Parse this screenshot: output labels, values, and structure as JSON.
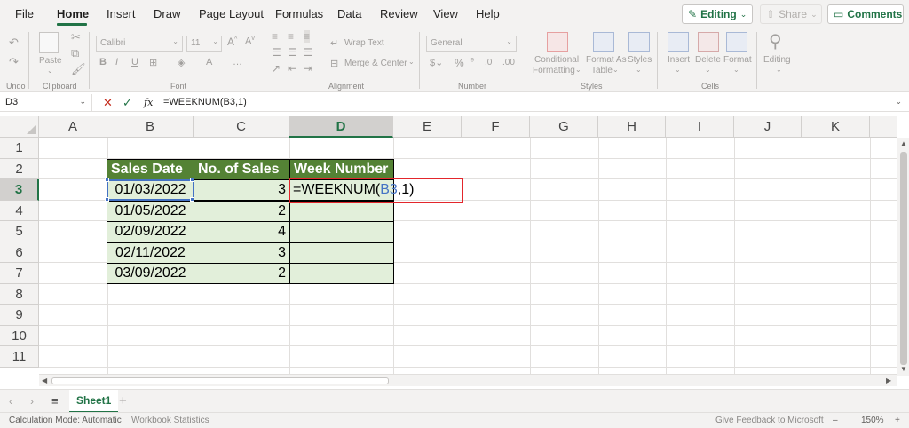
{
  "menu": {
    "tabs": [
      "File",
      "Home",
      "Insert",
      "Draw",
      "Page Layout",
      "Formulas",
      "Data",
      "Review",
      "View",
      "Help"
    ],
    "active": "Home",
    "editing_label": "Editing",
    "share_label": "Share",
    "comments_label": "Comments"
  },
  "ribbon": {
    "undo_group": "Undo",
    "clipboard_group": "Clipboard",
    "paste_label": "Paste",
    "font_name": "Calibri",
    "font_size": "11",
    "font_group": "Font",
    "wrap_text": "Wrap Text",
    "merge_center": "Merge & Center",
    "alignment_group": "Alignment",
    "number_format": "General",
    "number_group": "Number",
    "conditional_formatting_1": "Conditional",
    "conditional_formatting_2": "Formatting",
    "format_as_table_1": "Format As",
    "format_as_table_2": "Table",
    "styles_label": "Styles",
    "styles_group": "Styles",
    "insert_label": "Insert",
    "delete_label": "Delete",
    "format_label": "Format",
    "cells_group": "Cells",
    "editing_label": "Editing"
  },
  "formula_bar": {
    "name_box": "D3",
    "formula": "=WEEKNUM(B3,1)"
  },
  "grid": {
    "columns": [
      "A",
      "B",
      "C",
      "D",
      "E",
      "F",
      "G",
      "H",
      "I",
      "J",
      "K"
    ],
    "rows": [
      "1",
      "2",
      "3",
      "4",
      "5",
      "6",
      "7",
      "8",
      "9",
      "10",
      "11"
    ],
    "selected_column": "D",
    "selected_row": "3"
  },
  "table": {
    "headers": [
      "Sales Date",
      "No. of Sales",
      "Week Number"
    ],
    "rows": [
      {
        "date": "01/03/2022",
        "sales": "3"
      },
      {
        "date": "01/05/2022",
        "sales": "2"
      },
      {
        "date": "02/09/2022",
        "sales": "4"
      },
      {
        "date": "02/11/2022",
        "sales": "3"
      },
      {
        "date": "03/09/2022",
        "sales": "2"
      }
    ],
    "edit_prefix": "=WEEKNUM(",
    "edit_ref": "B3",
    "edit_suffix": ",1)"
  },
  "sheets": {
    "active": "Sheet1"
  },
  "status": {
    "calc_mode": "Calculation Mode: Automatic",
    "workbook_stats": "Workbook Statistics",
    "feedback": "Give Feedback to Microsoft",
    "zoom": "150%",
    "zoom_minus": "–",
    "zoom_plus": "+"
  },
  "colors": {
    "accent": "#217346",
    "header_fill": "#548235",
    "data_fill": "#e2efda",
    "selection": "#4472c4",
    "highlight_box": "#e3262c"
  }
}
